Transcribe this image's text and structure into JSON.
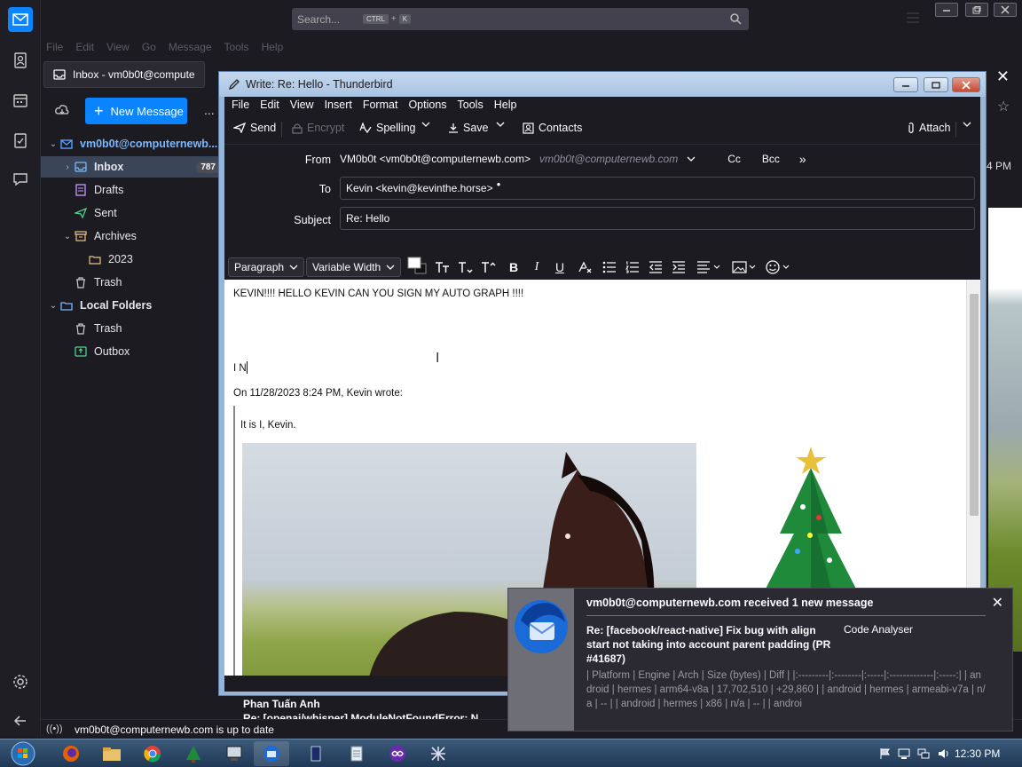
{
  "search": {
    "placeholder": "Search...",
    "key1": "CTRL",
    "plus": "+",
    "key2": "K"
  },
  "menubar": [
    "File",
    "Edit",
    "View",
    "Go",
    "Message",
    "Tools",
    "Help"
  ],
  "tabs": {
    "inbox_label": "Inbox - vm0b0t@compute"
  },
  "folder_pane": {
    "new_message": "New Message",
    "more": "...",
    "account": "vm0b0t@computernewb...",
    "folders": [
      {
        "label": "Inbox",
        "count": "787",
        "icon": "inbox-icon"
      },
      {
        "label": "Drafts",
        "icon": "drafts-icon"
      },
      {
        "label": "Sent",
        "icon": "sent-icon"
      },
      {
        "label": "Archives",
        "icon": "archive-icon"
      },
      {
        "label": "2023",
        "icon": "folder-icon"
      },
      {
        "label": "Trash",
        "icon": "trash-icon"
      }
    ],
    "local_folders": "Local Folders",
    "local": [
      {
        "label": "Trash",
        "icon": "trash-icon"
      },
      {
        "label": "Outbox",
        "icon": "outbox-icon"
      }
    ]
  },
  "message_list": {
    "time": "4 PM",
    "sender": "Phan Tuấn Anh",
    "next_subject": "Re: [openai/whisper] ModuleNotFoundError: N"
  },
  "status": {
    "text": "vm0b0t@computernewb.com is up to date"
  },
  "compose": {
    "title": "Write: Re: Hello - Thunderbird",
    "menu": [
      "File",
      "Edit",
      "View",
      "Insert",
      "Format",
      "Options",
      "Tools",
      "Help"
    ],
    "toolbar": {
      "send": "Send",
      "encrypt": "Encrypt",
      "spelling": "Spelling",
      "save": "Save",
      "contacts": "Contacts",
      "attach": "Attach"
    },
    "headers": {
      "from_label": "From",
      "from_value": "VM0b0t <vm0b0t@computernewb.com>",
      "from_ghost": "vm0b0t@computernewb.com",
      "cc": "Cc",
      "bcc": "Bcc",
      "to_label": "To",
      "to_value": "Kevin <kevin@kevinthe.horse>",
      "subject_label": "Subject",
      "subject_value": "Re: Hello"
    },
    "format": {
      "paragraph": "Paragraph",
      "font": "Variable Width"
    },
    "body": {
      "line1": "KEVIN!!!! HELLO KEVIN CAN YOU SIGN MY AUTO GRAPH !!!!",
      "line2": "I N",
      "quote_header": "On 11/28/2023 8:24 PM, Kevin wrote:",
      "quote_text": "It is I, Kevin."
    }
  },
  "notification": {
    "title": "vm0b0t@computernewb.com received 1 new message",
    "subject": "Re: [facebook/react-native] Fix bug with align start not taking into account parent padding (PR #41687)",
    "sender": "Code Analyser",
    "preview": "| Platform | Engine | Arch | Size (bytes) | Diff | |:---------|:--------|:-----|:-------------|:-----:| | android | hermes | arm64-v8a | 17,702,510 | +29,860 | | android | hermes | armeabi-v7a | n/a | -- | | android | hermes | x86 | n/a | -- | | androi"
  },
  "taskbar": {
    "clock": "12:30 PM"
  },
  "colors": {
    "accent": "#0a84ff",
    "dark_bg": "#1c1b22",
    "taskbar": "#1f3856"
  }
}
